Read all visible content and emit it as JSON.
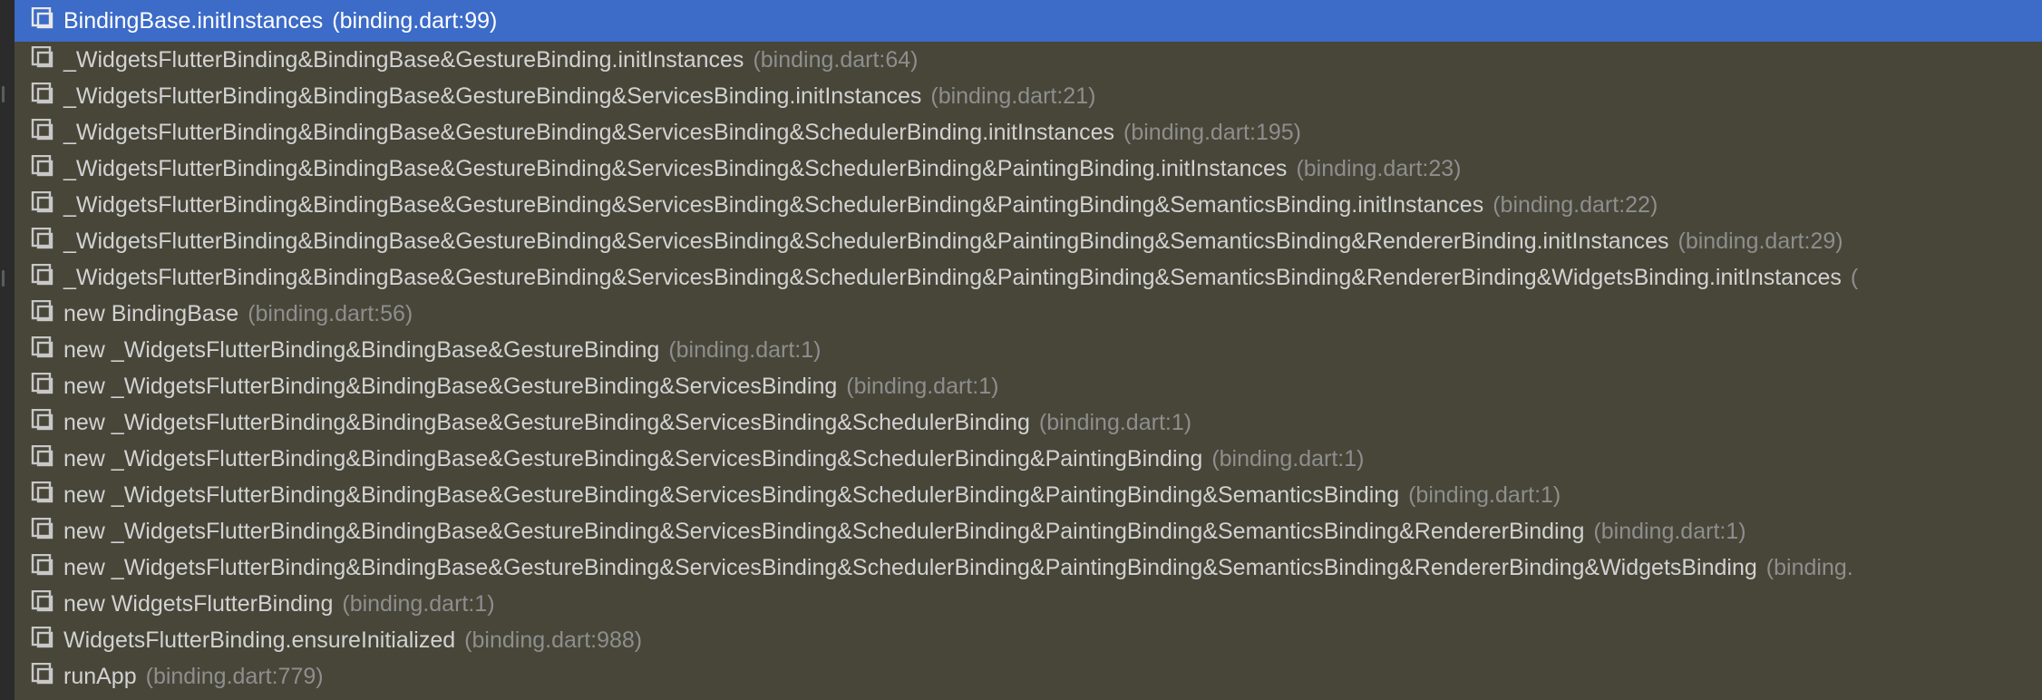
{
  "colors": {
    "list_background": "#474639",
    "selection": "#3c6bc8",
    "method_text": "#d2d2d2",
    "location_text": "#8e8e8e",
    "icon": "#c8c8c8"
  },
  "frames": [
    {
      "method": "BindingBase.initInstances",
      "location": "(binding.dart:99)",
      "icon": "frame-stack-icon"
    },
    {
      "method": "_WidgetsFlutterBinding&BindingBase&GestureBinding.initInstances",
      "location": "(binding.dart:64)",
      "icon": "frame-stack-icon"
    },
    {
      "method": "_WidgetsFlutterBinding&BindingBase&GestureBinding&ServicesBinding.initInstances",
      "location": "(binding.dart:21)",
      "icon": "frame-stack-icon"
    },
    {
      "method": "_WidgetsFlutterBinding&BindingBase&GestureBinding&ServicesBinding&SchedulerBinding.initInstances",
      "location": "(binding.dart:195)",
      "icon": "frame-stack-icon"
    },
    {
      "method": "_WidgetsFlutterBinding&BindingBase&GestureBinding&ServicesBinding&SchedulerBinding&PaintingBinding.initInstances",
      "location": "(binding.dart:23)",
      "icon": "frame-stack-icon"
    },
    {
      "method": "_WidgetsFlutterBinding&BindingBase&GestureBinding&ServicesBinding&SchedulerBinding&PaintingBinding&SemanticsBinding.initInstances",
      "location": "(binding.dart:22)",
      "icon": "frame-stack-icon"
    },
    {
      "method": "_WidgetsFlutterBinding&BindingBase&GestureBinding&ServicesBinding&SchedulerBinding&PaintingBinding&SemanticsBinding&RendererBinding.initInstances",
      "location": "(binding.dart:29)",
      "icon": "frame-stack-icon"
    },
    {
      "method": "_WidgetsFlutterBinding&BindingBase&GestureBinding&ServicesBinding&SchedulerBinding&PaintingBinding&SemanticsBinding&RendererBinding&WidgetsBinding.initInstances",
      "location": "(",
      "icon": "frame-stack-icon"
    },
    {
      "method": "new BindingBase",
      "location": "(binding.dart:56)",
      "icon": "frame-stack-icon"
    },
    {
      "method": "new _WidgetsFlutterBinding&BindingBase&GestureBinding",
      "location": "(binding.dart:1)",
      "icon": "frame-stack-icon"
    },
    {
      "method": "new _WidgetsFlutterBinding&BindingBase&GestureBinding&ServicesBinding",
      "location": "(binding.dart:1)",
      "icon": "frame-stack-icon"
    },
    {
      "method": "new _WidgetsFlutterBinding&BindingBase&GestureBinding&ServicesBinding&SchedulerBinding",
      "location": "(binding.dart:1)",
      "icon": "frame-stack-icon"
    },
    {
      "method": "new _WidgetsFlutterBinding&BindingBase&GestureBinding&ServicesBinding&SchedulerBinding&PaintingBinding",
      "location": "(binding.dart:1)",
      "icon": "frame-stack-icon"
    },
    {
      "method": "new _WidgetsFlutterBinding&BindingBase&GestureBinding&ServicesBinding&SchedulerBinding&PaintingBinding&SemanticsBinding",
      "location": "(binding.dart:1)",
      "icon": "frame-stack-icon"
    },
    {
      "method": "new _WidgetsFlutterBinding&BindingBase&GestureBinding&ServicesBinding&SchedulerBinding&PaintingBinding&SemanticsBinding&RendererBinding",
      "location": "(binding.dart:1)",
      "icon": "frame-stack-icon"
    },
    {
      "method": "new _WidgetsFlutterBinding&BindingBase&GestureBinding&ServicesBinding&SchedulerBinding&PaintingBinding&SemanticsBinding&RendererBinding&WidgetsBinding",
      "location": "(binding.",
      "icon": "frame-stack-icon"
    },
    {
      "method": "new WidgetsFlutterBinding",
      "location": "(binding.dart:1)",
      "icon": "frame-stack-icon"
    },
    {
      "method": "WidgetsFlutterBinding.ensureInitialized",
      "location": "(binding.dart:988)",
      "icon": "frame-stack-icon"
    },
    {
      "method": "runApp",
      "location": "(binding.dart:779)",
      "icon": "frame-stack-icon"
    }
  ]
}
